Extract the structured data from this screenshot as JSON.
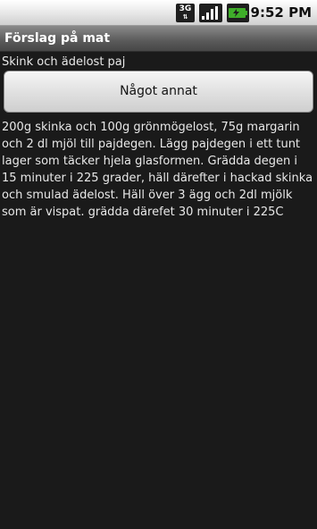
{
  "status_bar": {
    "network_label": "3G",
    "network_icon": "3g-data-icon",
    "signal_icon": "signal-strength-icon",
    "battery_icon": "battery-charging-icon",
    "time": "9:52 PM",
    "battery_color": "#3fae2a"
  },
  "app": {
    "title": "Förslag på mat"
  },
  "main": {
    "dish_name": "Skink och ädelost paj",
    "other_button_label": "Något annat",
    "recipe": "200g skinka och 100g grönmögelost, 75g margarin och 2 dl mjöl till pajdegen. Lägg pajdegen i ett tunt lager som täcker hjela glasformen. Grädda degen i 15 minuter i 225 grader, häll därefter i hackad skinka och smulad ädelost. Häll över 3 ägg och 2dl mjölk som är vispat. grädda därefet 30 minuter i 225C"
  }
}
